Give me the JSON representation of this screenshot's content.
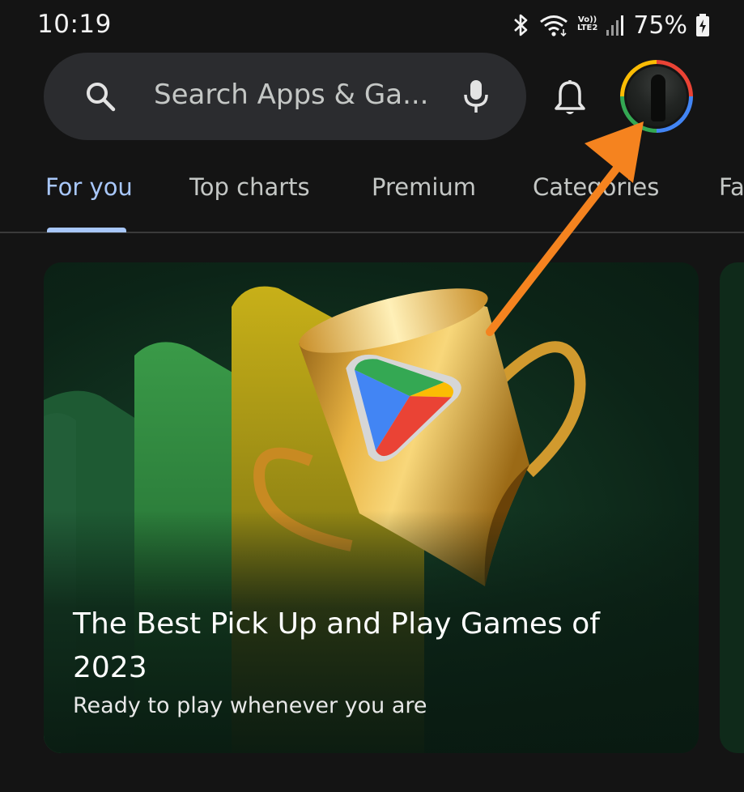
{
  "status_bar": {
    "time": "10:19",
    "network_top": "Vo))",
    "network_bottom": "LTE2",
    "battery_percent": "75%"
  },
  "search": {
    "placeholder": "Search Apps & Ga..."
  },
  "tabs": [
    {
      "label": "For you",
      "active": true
    },
    {
      "label": "Top charts",
      "active": false
    },
    {
      "label": "Premium",
      "active": false
    },
    {
      "label": "Categories",
      "active": false
    },
    {
      "label": "Fa",
      "active": false
    }
  ],
  "feature_card": {
    "title": "The Best Pick Up and Play Games of 2023",
    "subtitle": "Ready to play whenever you are"
  },
  "colors": {
    "accent": "#a8c7fa",
    "annotation_arrow": "#f5831f",
    "card_bg": "#123521"
  },
  "icons": [
    "search-icon",
    "mic-icon",
    "bell-icon",
    "bluetooth-icon",
    "wifi-icon",
    "signal-icon",
    "battery-icon"
  ]
}
